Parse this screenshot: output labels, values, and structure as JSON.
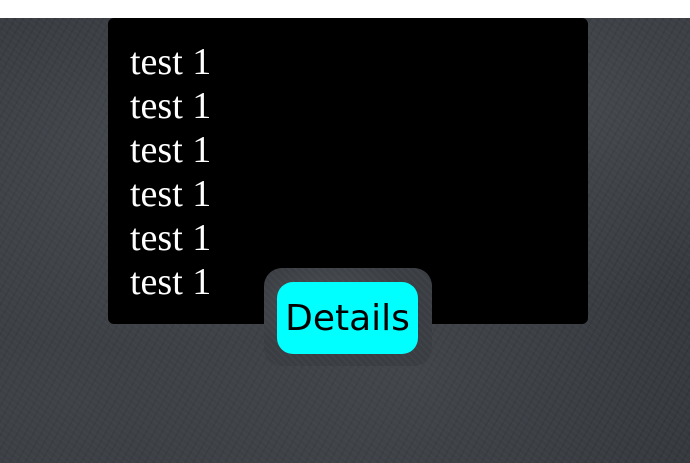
{
  "panel": {
    "lines": [
      "test 1",
      "test 1",
      "test 1",
      "test 1",
      "test 1",
      "test 1"
    ]
  },
  "button": {
    "label": "Details"
  },
  "colors": {
    "panel_bg": "#000000",
    "text": "#ffffff",
    "button_bg": "#00ffff",
    "button_text": "#000000",
    "backdrop": "#363a3f"
  }
}
